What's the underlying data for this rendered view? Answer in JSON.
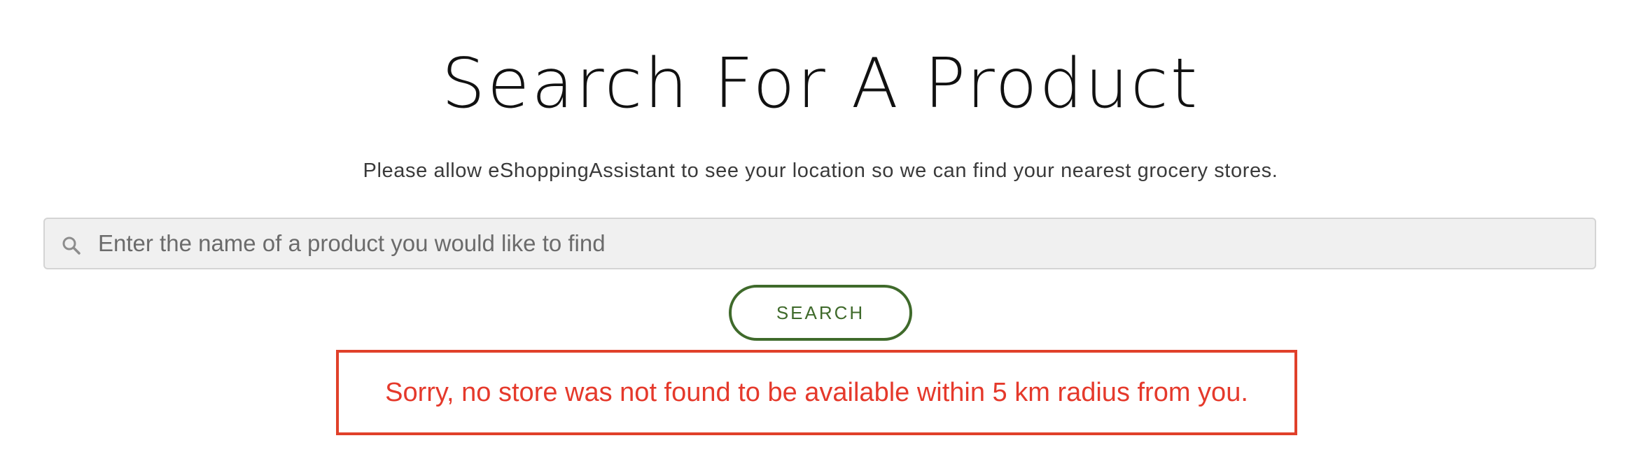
{
  "page": {
    "title": "Search For A Product",
    "subtitle": "Please allow eShoppingAssistant to see your location so we can find your nearest grocery stores."
  },
  "search": {
    "placeholder": "Enter the name of a product you would like to find",
    "value": "",
    "icon": "search-icon",
    "button_label": "SEARCH"
  },
  "error": {
    "message": "Sorry, no store was not found to be available within 5 km radius from you."
  },
  "colors": {
    "accent_green": "#3f6a2b",
    "error_red": "#e0402a",
    "input_bg": "#f0f0f0"
  }
}
